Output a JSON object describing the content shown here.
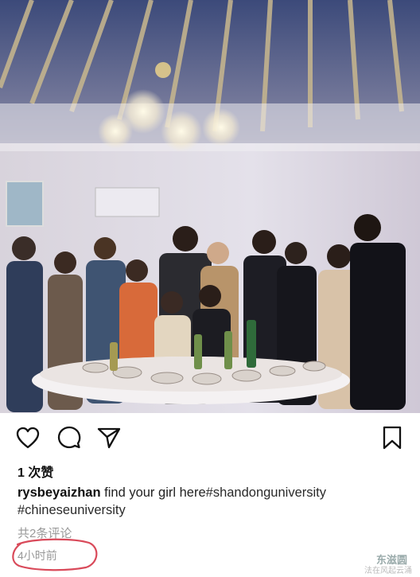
{
  "post": {
    "likes_text": "1 次赞",
    "username": "rysbeyaizhan",
    "caption_text": " find your girl here",
    "hashtag_1": "#shandonguniversity",
    "hashtag_2": "#chineseuniversity",
    "comments_text": "共2条评论",
    "time_text": "4小时前"
  },
  "icons": {
    "like": "heart-icon",
    "comment": "comment-bubble-icon",
    "share": "paper-plane-icon",
    "save": "bookmark-icon"
  },
  "annotation": {
    "circle_color": "#d94a5a"
  },
  "watermark": {
    "line1": "东滋圆",
    "line2": "法在风起云涌"
  }
}
